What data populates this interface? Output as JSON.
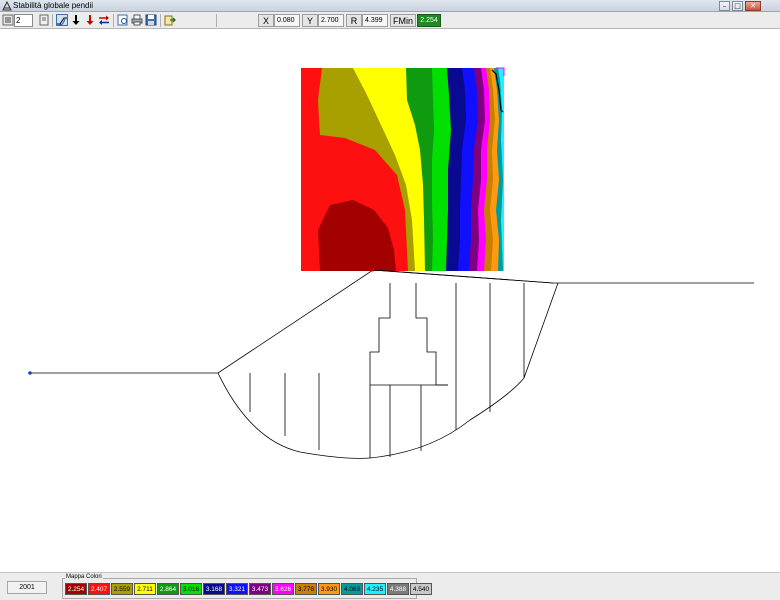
{
  "window": {
    "title": "Stabilità globale pendii"
  },
  "toolbar": {
    "page_value": "2",
    "x_label": "X",
    "x_value": "0.080",
    "y_label": "Y",
    "y_value": "2.700",
    "r_label": "R",
    "r_value": "4.399",
    "fmin_label": "FMin",
    "fmin_value": "2.254",
    "icons": [
      "menu-icon",
      "page-icon",
      "slope-icon",
      "arrow-down-black-icon",
      "arrow-down-red-icon",
      "swap-arrows-icon",
      "preview-icon",
      "print-icon",
      "save-icon",
      "export-icon"
    ]
  },
  "colors": {
    "accent_green": "#1f8a22",
    "outline": "#000000"
  },
  "status": {
    "count": "2001"
  },
  "legend": {
    "title": "Mappa Colori",
    "items": [
      {
        "value": "2.254",
        "color": "#a30000",
        "text_color": "#ffffff"
      },
      {
        "value": "2.407",
        "color": "#ff1010",
        "text_color": "#ffffff"
      },
      {
        "value": "2.559",
        "color": "#a8a000",
        "text_color": "#000000"
      },
      {
        "value": "2.711",
        "color": "#ffff00",
        "text_color": "#000000"
      },
      {
        "value": "2.864",
        "color": "#109a10",
        "text_color": "#ffffff"
      },
      {
        "value": "3.016",
        "color": "#00e000",
        "text_color": "#000000"
      },
      {
        "value": "3.168",
        "color": "#0a0a90",
        "text_color": "#ffffff"
      },
      {
        "value": "3.321",
        "color": "#1010ff",
        "text_color": "#ffffff"
      },
      {
        "value": "3.473",
        "color": "#800080",
        "text_color": "#ffffff"
      },
      {
        "value": "3.626",
        "color": "#ff00ff",
        "text_color": "#ffffff"
      },
      {
        "value": "3.778",
        "color": "#c88000",
        "text_color": "#000000"
      },
      {
        "value": "3.930",
        "color": "#ff9a10",
        "text_color": "#000000"
      },
      {
        "value": "4.083",
        "color": "#009c9c",
        "text_color": "#000000"
      },
      {
        "value": "4.235",
        "color": "#20f0ff",
        "text_color": "#000000"
      },
      {
        "value": "4.388",
        "color": "#7a7a7a",
        "text_color": "#ffffff"
      },
      {
        "value": "4.540",
        "color": "#c8c8c8",
        "text_color": "#000000"
      }
    ]
  }
}
